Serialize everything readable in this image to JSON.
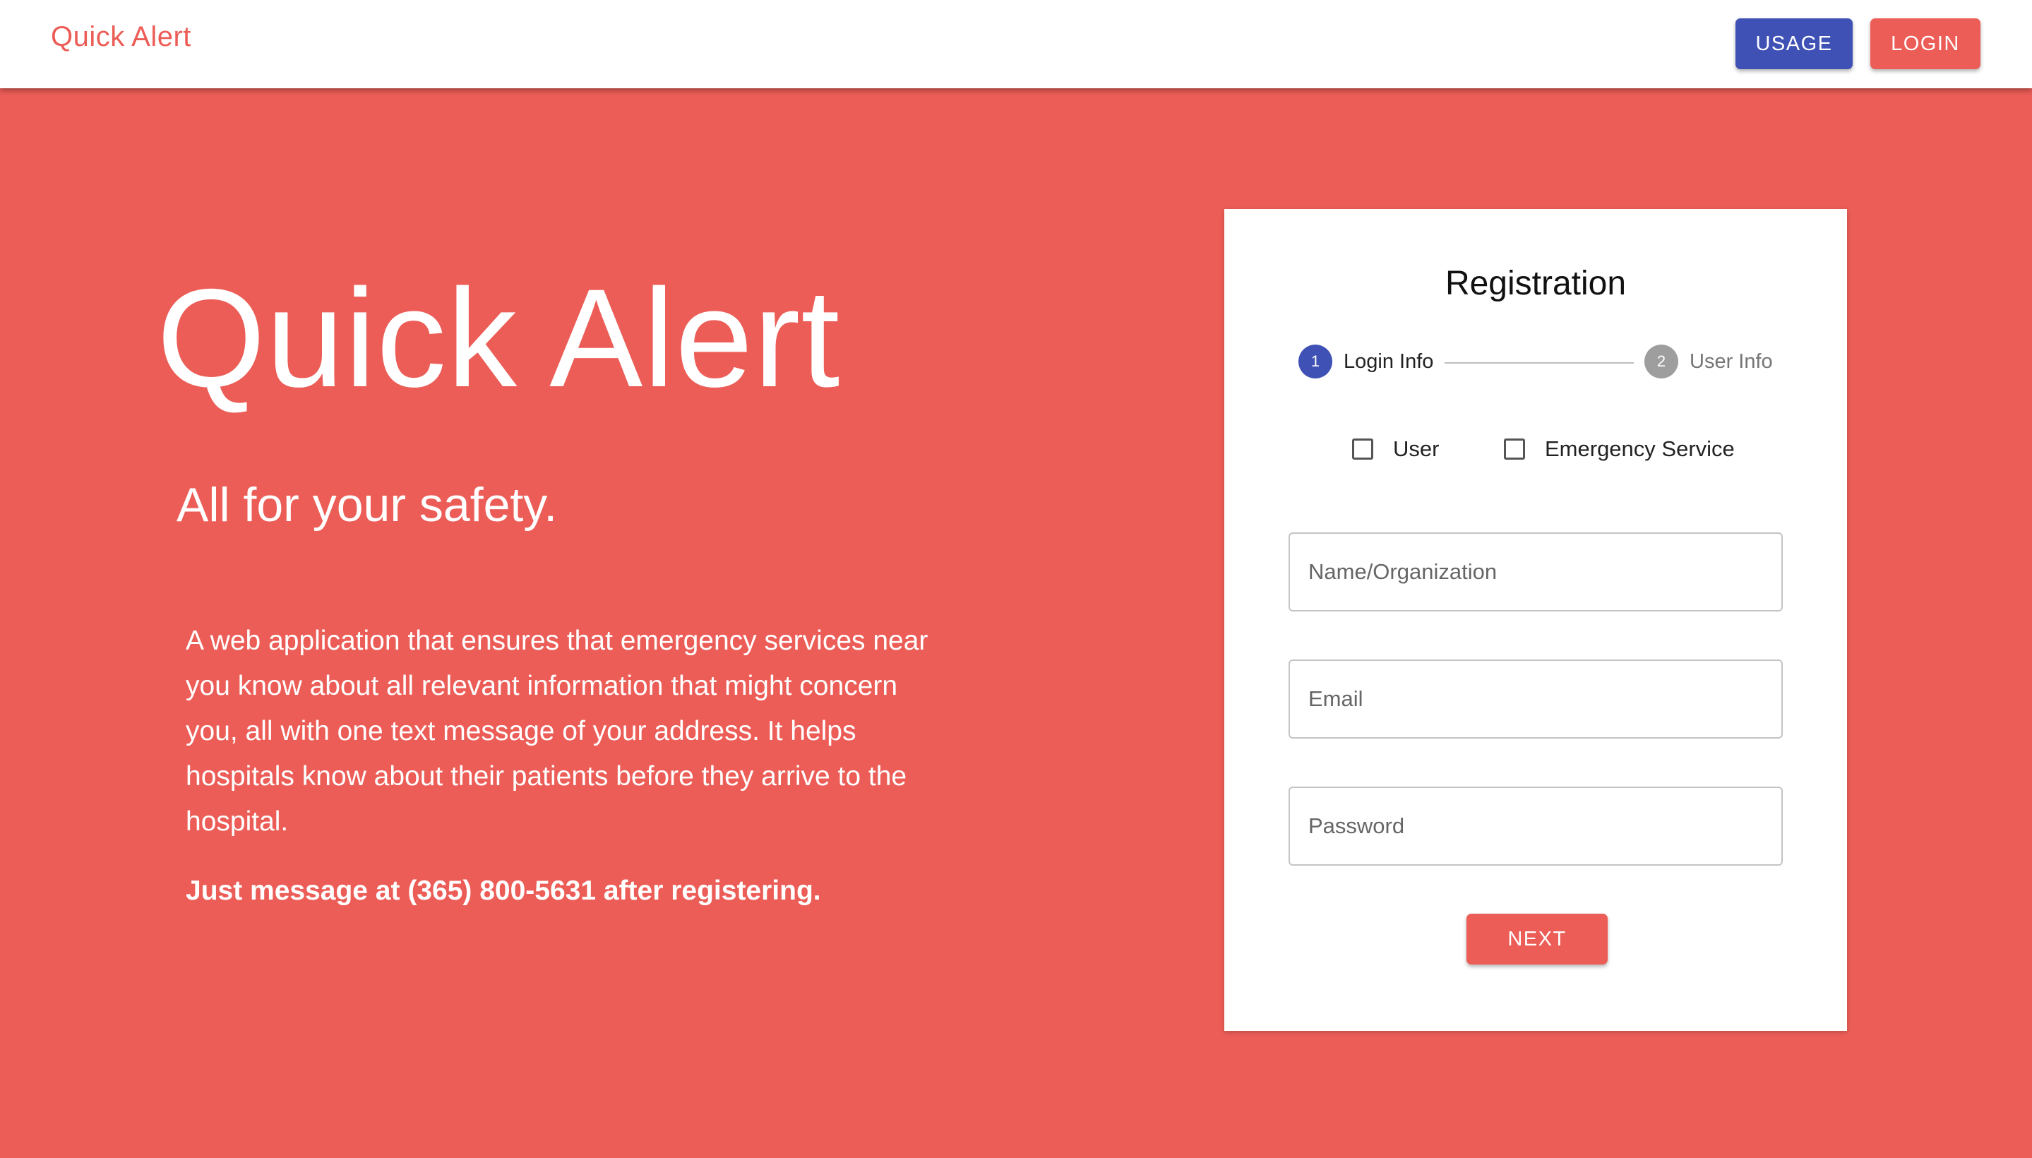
{
  "appbar": {
    "brand": "Quick Alert",
    "usage_label": "USAGE",
    "login_label": "LOGIN"
  },
  "hero": {
    "title": "Quick Alert",
    "subtitle": "All for your safety.",
    "description": "A web application that ensures that emergency services near you know about all relevant information that might concern you, all with one text message of your address. It helps hospitals know about their patients before they arrive to the hospital.",
    "cta": "Just message at (365) 800-5631 after registering."
  },
  "registration": {
    "title": "Registration",
    "steps": [
      {
        "number": "1",
        "label": "Login Info",
        "active": true
      },
      {
        "number": "2",
        "label": "User Info",
        "active": false
      }
    ],
    "checkboxes": [
      {
        "label": "User",
        "checked": false
      },
      {
        "label": "Emergency Service",
        "checked": false
      }
    ],
    "fields": {
      "name": {
        "placeholder": "Name/Organization",
        "value": ""
      },
      "email": {
        "placeholder": "Email",
        "value": ""
      },
      "password": {
        "placeholder": "Password",
        "value": ""
      }
    },
    "next_label": "NEXT"
  },
  "colors": {
    "brand": "#ec5d57",
    "primary": "#3f51b5",
    "inactive_step": "#9e9e9e"
  }
}
